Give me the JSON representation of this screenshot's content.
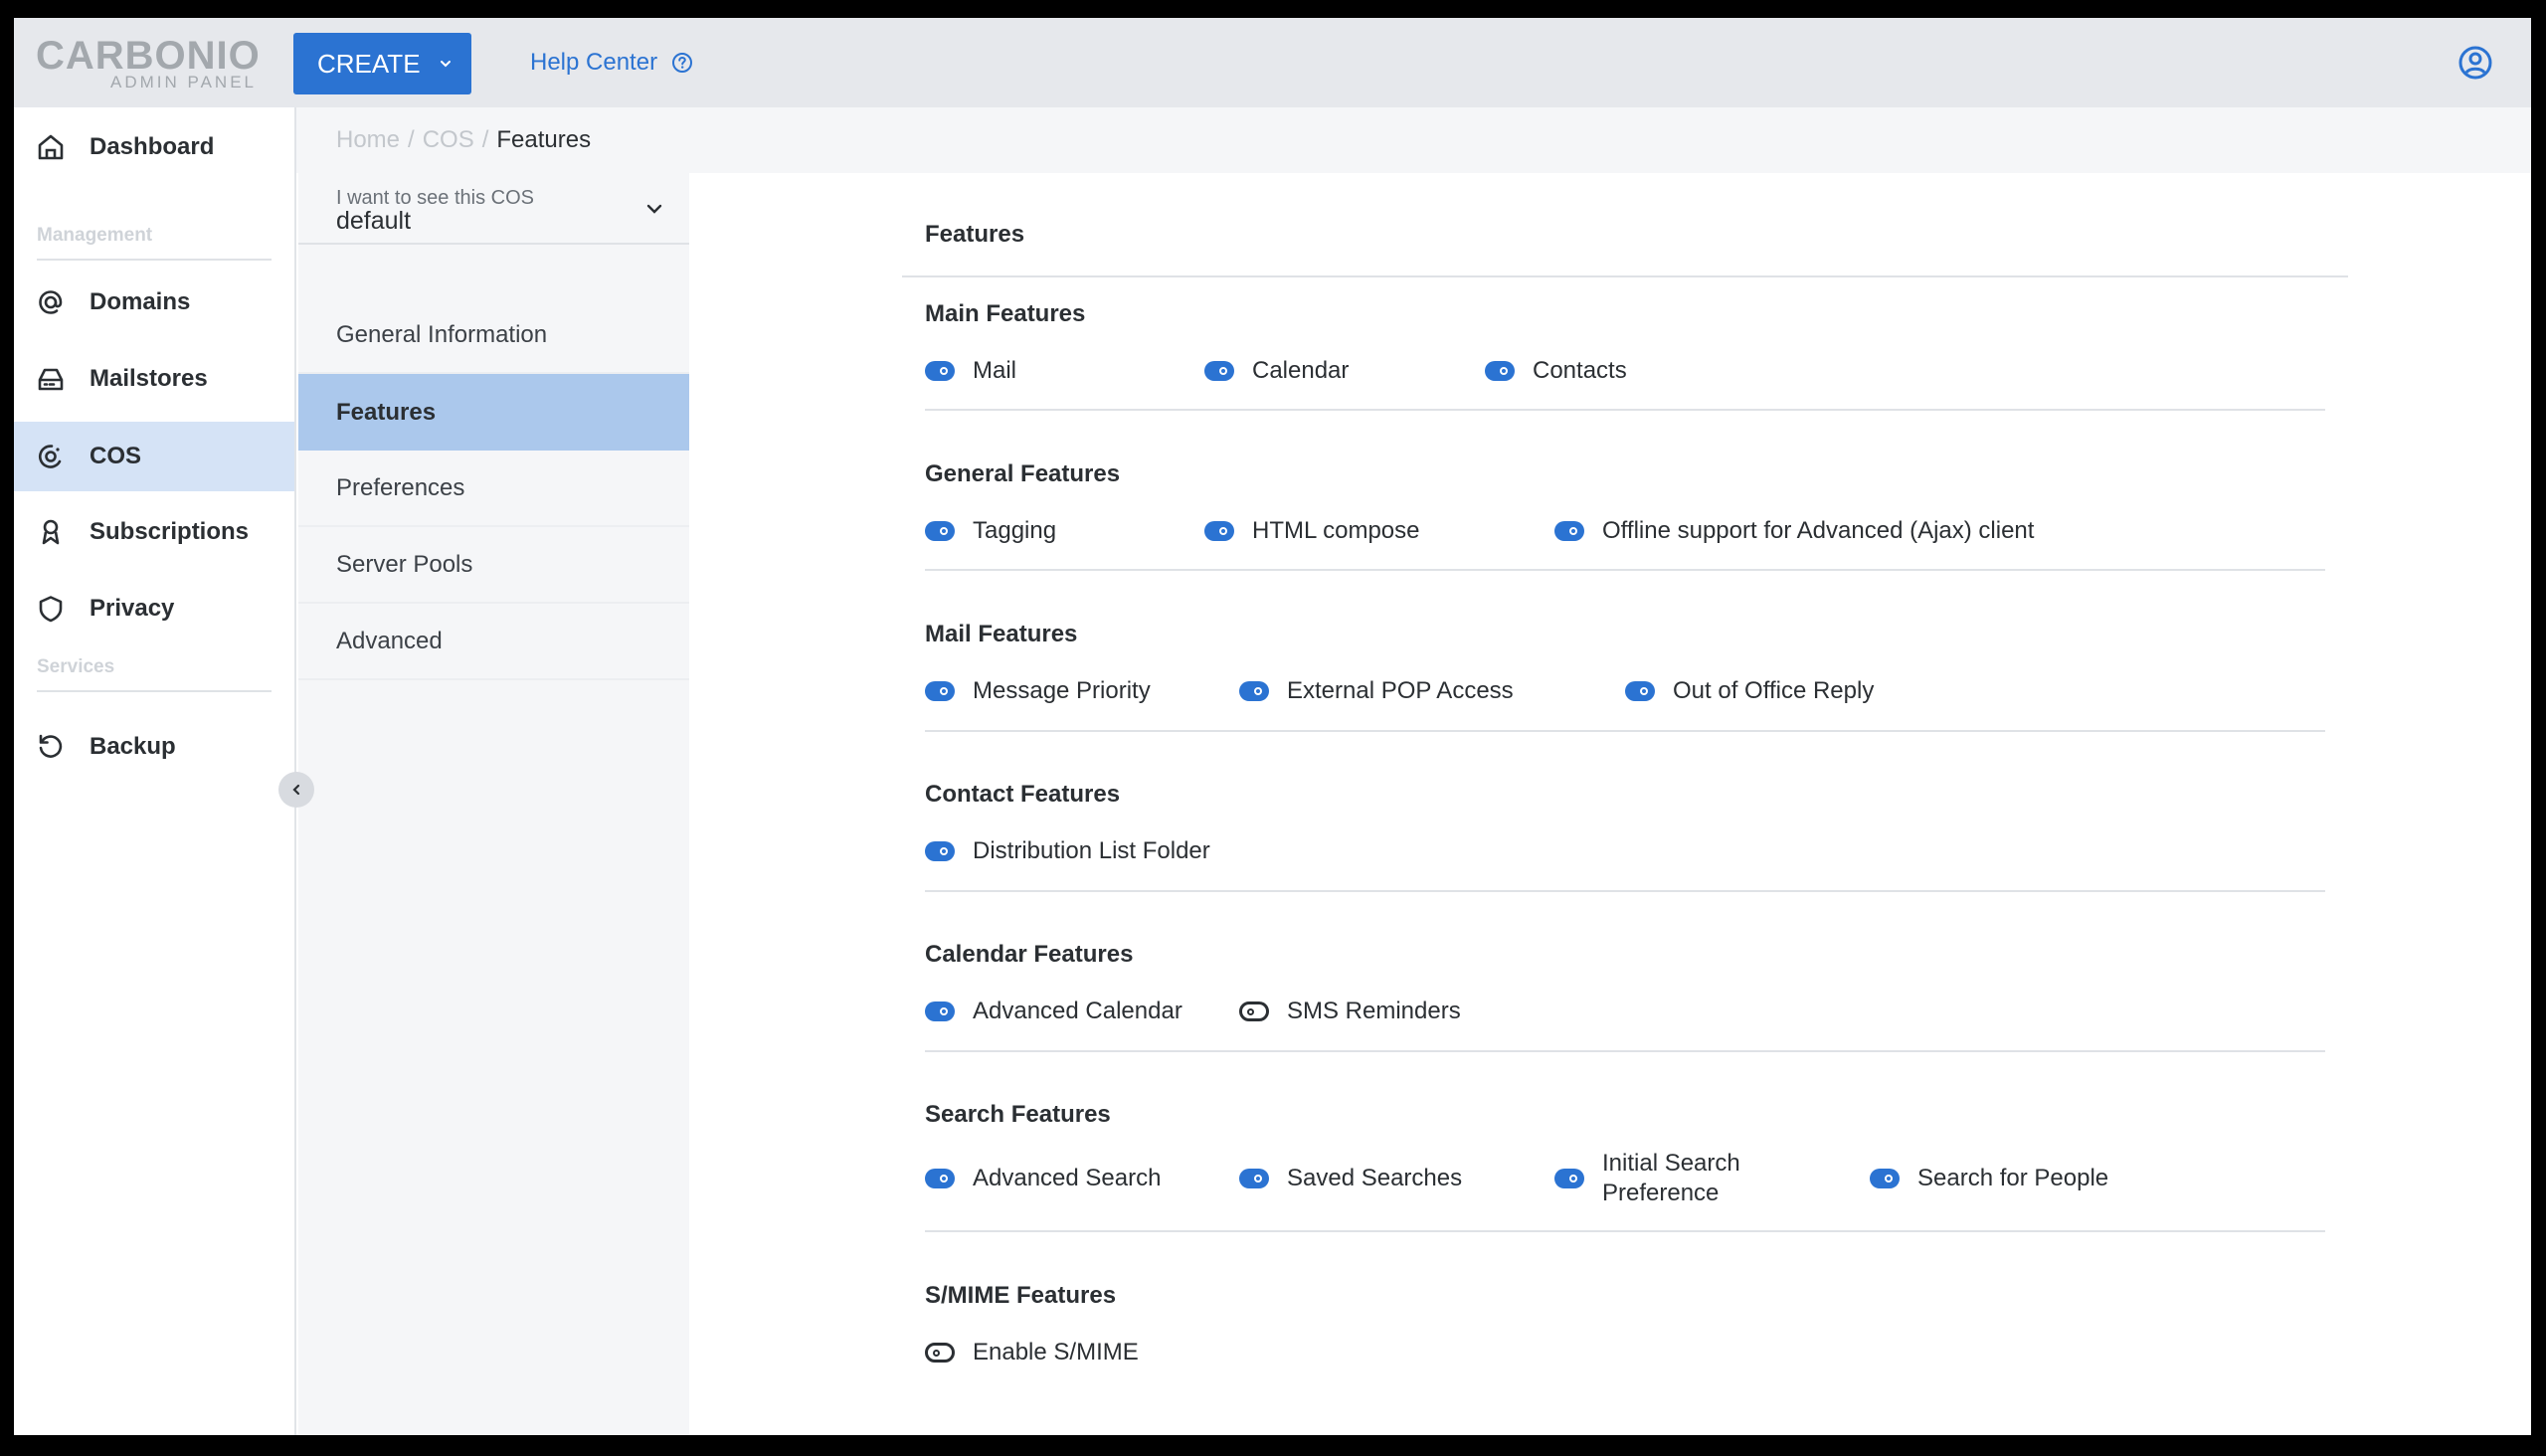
{
  "header": {
    "logo_main": "CARBONIO",
    "logo_sub": "ADMIN PANEL",
    "create_label": "CREATE",
    "help_label": "Help Center"
  },
  "sidebar": {
    "items": [
      {
        "label": "Dashboard",
        "icon": "home-icon"
      },
      {
        "label": "Domains",
        "icon": "at-sign-icon"
      },
      {
        "label": "Mailstores",
        "icon": "hard-drive-icon"
      },
      {
        "label": "COS",
        "icon": "cos-icon",
        "active": true
      },
      {
        "label": "Subscriptions",
        "icon": "award-icon"
      },
      {
        "label": "Privacy",
        "icon": "shield-icon"
      },
      {
        "label": "Backup",
        "icon": "refresh-icon"
      }
    ],
    "sections": [
      "Management",
      "Services"
    ]
  },
  "breadcrumb": {
    "items": [
      "Home",
      "COS"
    ],
    "separator": "/",
    "current": "Features"
  },
  "cos_select": {
    "caption": "I want to see this COS",
    "value": "default"
  },
  "subnav": {
    "items": [
      "General Information",
      "Features",
      "Preferences",
      "Server Pools",
      "Advanced"
    ],
    "active": "Features"
  },
  "main": {
    "title": "Features",
    "sections": [
      {
        "title": "Main Features",
        "features": [
          {
            "label": "Mail",
            "enabled": true
          },
          {
            "label": "Calendar",
            "enabled": true
          },
          {
            "label": "Contacts",
            "enabled": true
          }
        ]
      },
      {
        "title": "General Features",
        "features": [
          {
            "label": "Tagging",
            "enabled": true
          },
          {
            "label": "HTML compose",
            "enabled": true
          },
          {
            "label": "Offline support for Advanced (Ajax) client",
            "enabled": true
          }
        ]
      },
      {
        "title": "Mail Features",
        "features": [
          {
            "label": "Message Priority",
            "enabled": true
          },
          {
            "label": "External POP Access",
            "enabled": true
          },
          {
            "label": "Out of Office Reply",
            "enabled": true
          }
        ]
      },
      {
        "title": "Contact Features",
        "features": [
          {
            "label": "Distribution List Folder",
            "enabled": true
          }
        ]
      },
      {
        "title": "Calendar Features",
        "features": [
          {
            "label": "Advanced Calendar",
            "enabled": true
          },
          {
            "label": "SMS Reminders",
            "enabled": false
          }
        ]
      },
      {
        "title": "Search Features",
        "features": [
          {
            "label": "Advanced Search",
            "enabled": true
          },
          {
            "label": "Saved Searches",
            "enabled": true
          },
          {
            "label": "Initial Search Preference",
            "enabled": true
          },
          {
            "label": "Search for People",
            "enabled": true
          }
        ]
      },
      {
        "title": "S/MIME Features",
        "features": [
          {
            "label": "Enable S/MIME",
            "enabled": false
          }
        ]
      }
    ]
  },
  "colors": {
    "accent": "#2b73d2",
    "sidebar_active": "#d5e3f6",
    "subnav_active": "#abc8ec"
  }
}
